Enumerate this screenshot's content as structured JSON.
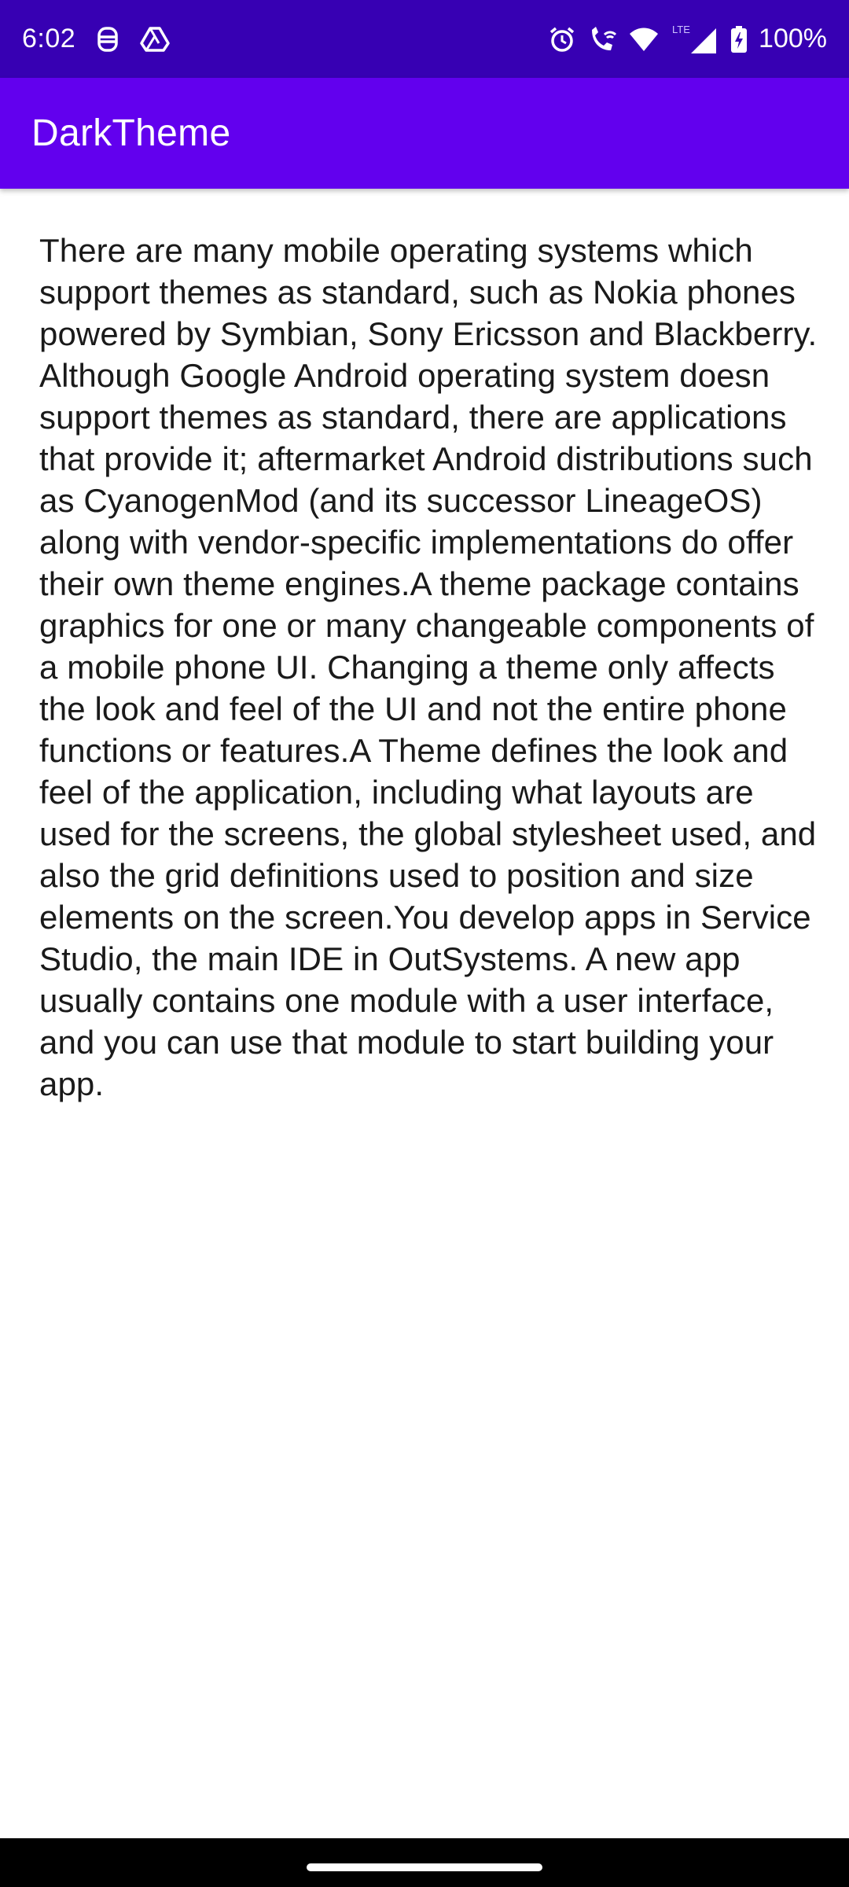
{
  "status_bar": {
    "time": "6:02",
    "left_icons": [
      "tasker-icon",
      "drive-icon"
    ],
    "right_icons": [
      "alarm-icon",
      "wifi-calling-icon",
      "wifi-icon",
      "lte-signal-icon",
      "battery-charging-icon"
    ],
    "lte_label": "LTE",
    "battery": "100%",
    "background": "#3700b3"
  },
  "app_bar": {
    "title": "DarkTheme",
    "background": "#6200ee"
  },
  "content": {
    "text": "There are many mobile operating systems which support themes as standard, such as Nokia phones powered by Symbian, Sony Ericsson and Blackberry. Although Google Android operating system doesn support themes as standard, there are applications that provide it; aftermarket Android distributions such as CyanogenMod (and its successor LineageOS) along with vendor-specific implementations do offer their own theme engines.A theme package contains graphics for one or many changeable components of a mobile phone UI. Changing a theme only affects the look and feel of the UI and not the entire phone functions or features.A Theme defines the look and feel of the application, including what layouts are used for the screens, the global stylesheet used, and also the grid definitions used to position and size elements on the screen.You develop apps in Service Studio, the main IDE in OutSystems. A new app usually contains one module with a user interface, and you can use that module to start building your app."
  }
}
